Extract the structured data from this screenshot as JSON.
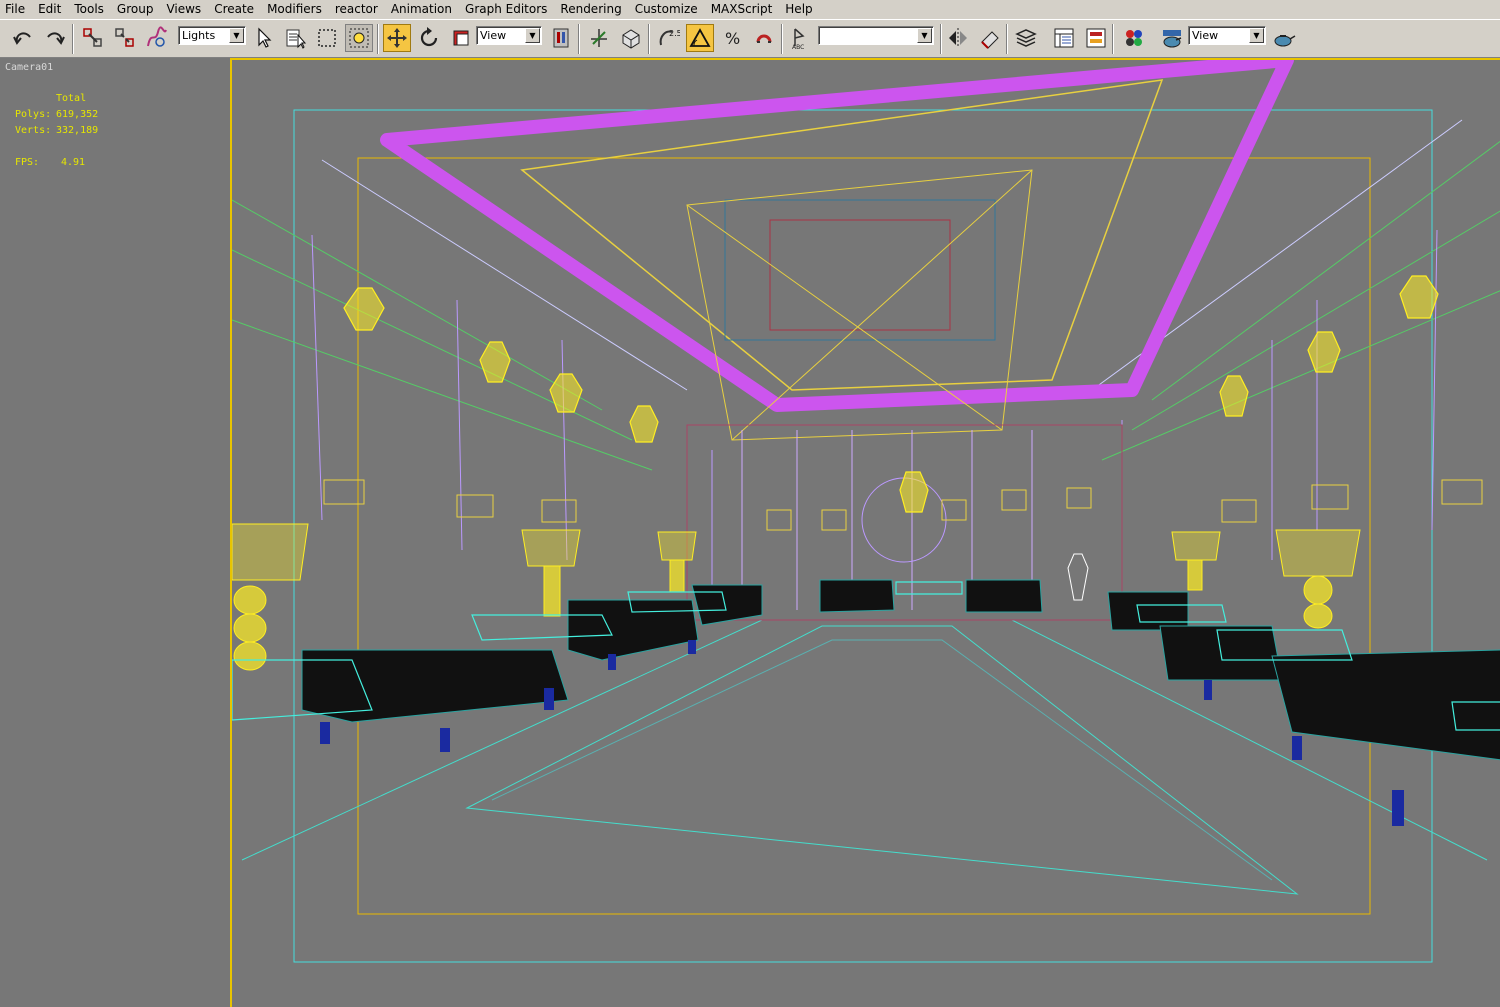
{
  "menu": [
    {
      "label": "File"
    },
    {
      "label": "Edit"
    },
    {
      "label": "Tools"
    },
    {
      "label": "Group"
    },
    {
      "label": "Views"
    },
    {
      "label": "Create"
    },
    {
      "label": "Modifiers"
    },
    {
      "label": "reactor"
    },
    {
      "label": "Animation"
    },
    {
      "label": "Graph Editors"
    },
    {
      "label": "Rendering"
    },
    {
      "label": "Customize"
    },
    {
      "label": "MAXScript"
    },
    {
      "label": "Help"
    }
  ],
  "toolbar": {
    "selection_filter": "Lights",
    "ref_coord_system": "View",
    "named_selection": "",
    "render_dropdown": "View",
    "snap_label": "2.5",
    "active_tool": "select-and-move",
    "icons": [
      "undo-icon",
      "redo-icon",
      "link-icon",
      "unlink-icon",
      "bind-space-warp-icon",
      "select-icon",
      "select-by-name-icon",
      "rect-selection-icon",
      "window-crossing-icon",
      "move-icon",
      "rotate-icon",
      "scale-icon",
      "mirror-icon",
      "snap-icon",
      "angle-snap-icon",
      "percent-snap-icon",
      "spinner-snap-icon",
      "edit-named-selections-icon",
      "align-icon",
      "layer-manager-icon",
      "curve-editor-icon",
      "schematic-icon",
      "material-editor-icon",
      "render-scene-icon",
      "quick-render-icon"
    ]
  },
  "viewport": {
    "label": "Camera01",
    "stats": {
      "total_label": "Total",
      "polys_label": "Polys:",
      "polys_value": "619,352",
      "verts_label": "Verts:",
      "verts_value": "332,189",
      "fps_label": "FPS:",
      "fps_value": "4.91"
    },
    "colors": {
      "background": "#777777",
      "ceiling_trim": "#cc55ee",
      "lights": "#ffee22",
      "sofas": "#111111",
      "tables": "#44eedd",
      "walls": "#bb99ff",
      "safe_frame": "#44dddd",
      "render_frame": "#e8b800"
    }
  }
}
